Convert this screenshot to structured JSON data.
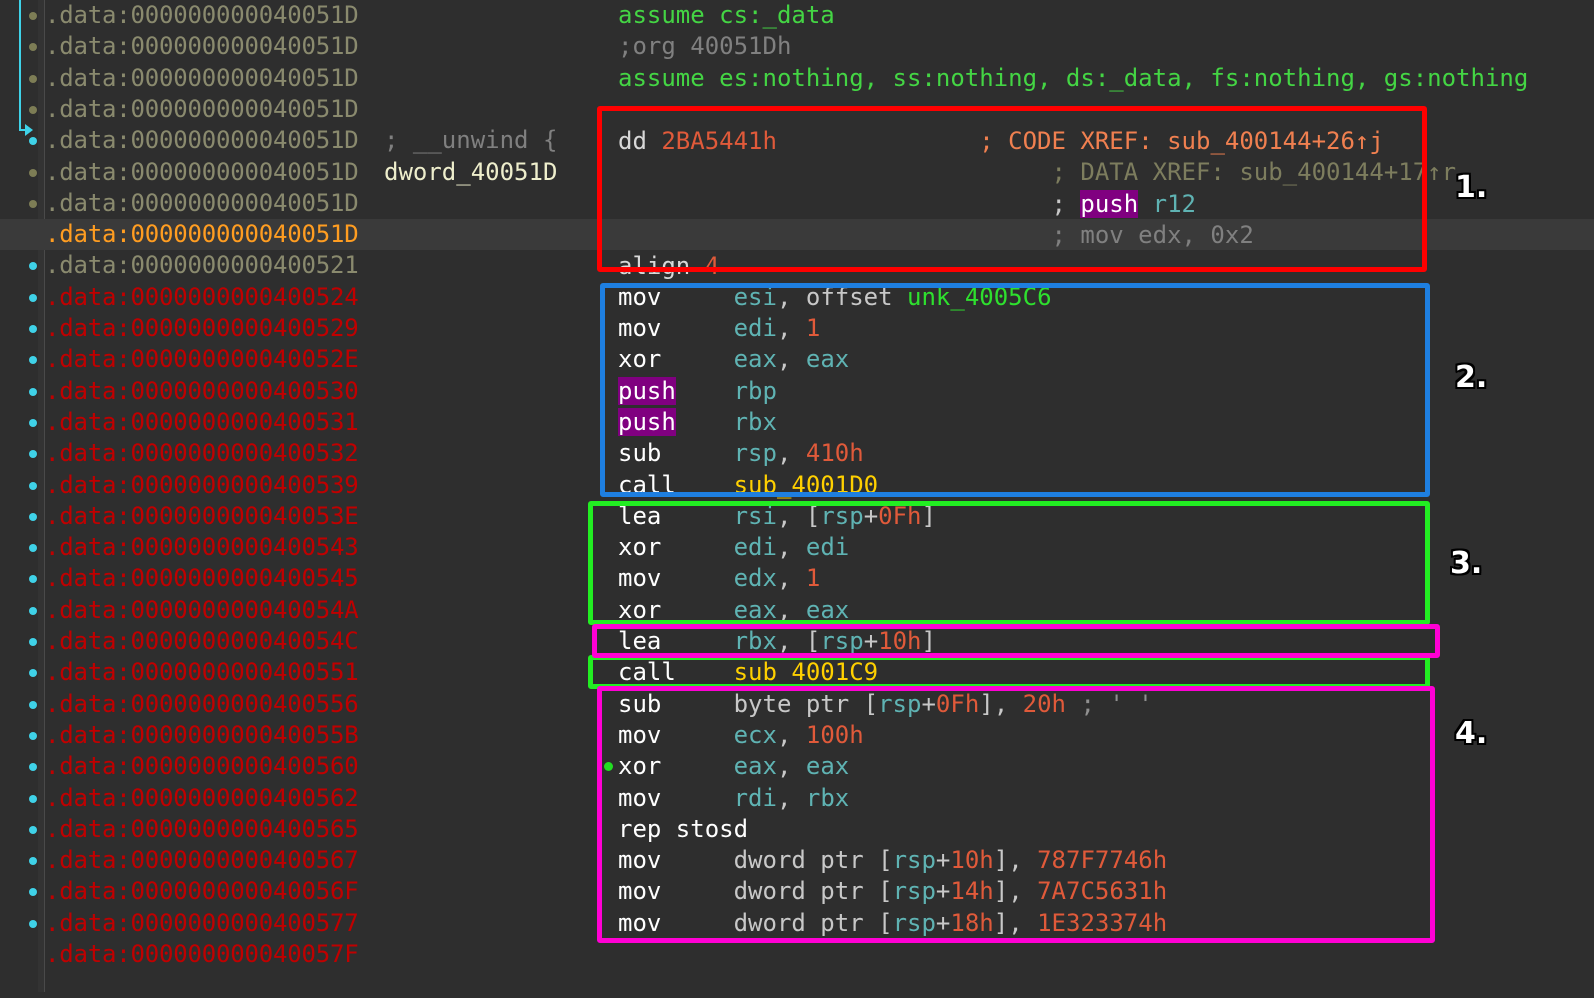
{
  "view": {
    "name": "IDA Pro disassembly listing",
    "segment": ".data",
    "background": "#2e2e2e",
    "current_line_background": "#3a3a3a"
  },
  "colors": {
    "address_grey": "#8a8a6e",
    "address_red": "#c00000",
    "address_current": "#ff9d21",
    "directive_green": "#44d544",
    "dim_grey": "#808080",
    "name_cream": "#eeeecc",
    "immediate_orange": "#e05a3a",
    "register_teal": "#5fb3b3",
    "xref_code_orange": "#f08050",
    "xref_data_olive": "#7d7d5e",
    "call_yellow": "#ffd000",
    "unk_green": "#2ee02e",
    "highlight_purple": "#800080",
    "marker_cyan": "#3fd2e8",
    "breakpoint_olive": "#7d7d55",
    "exec_dot_green": "#22dd22",
    "box_1_red": "#ff0000",
    "box_2_blue": "#1e7fe0",
    "box_3_green": "#22ee22",
    "box_4_magenta": "#ff00d4"
  },
  "gutter": {
    "arrow_icon": "jump-arrow-icon",
    "arrow_target_dot": "cyan-dot",
    "marker_dots": "breakpoint-dot"
  },
  "address_lines": [
    {
      "text": ".data:000000000040051D",
      "color": "grey",
      "dot": "olive",
      "current": false
    },
    {
      "text": ".data:000000000040051D",
      "color": "grey",
      "dot": "olive",
      "current": false
    },
    {
      "text": ".data:000000000040051D",
      "color": "grey",
      "dot": "olive",
      "current": false
    },
    {
      "text": ".data:000000000040051D",
      "color": "grey",
      "dot": "olive",
      "current": false
    },
    {
      "text": ".data:000000000040051D",
      "color": "grey",
      "dot": "cyan",
      "current": false
    },
    {
      "text": ".data:000000000040051D",
      "color": "grey",
      "dot": "olive",
      "current": false
    },
    {
      "text": ".data:000000000040051D",
      "color": "grey",
      "dot": "olive",
      "current": false
    },
    {
      "text": ".data:000000000040051D",
      "color": "cur",
      "dot": "",
      "current": true
    },
    {
      "text": ".data:0000000000400521",
      "color": "grey",
      "dot": "cyan",
      "current": false
    },
    {
      "text": ".data:0000000000400524",
      "color": "red",
      "dot": "cyan",
      "current": false
    },
    {
      "text": ".data:0000000000400529",
      "color": "red",
      "dot": "cyan",
      "current": false
    },
    {
      "text": ".data:000000000040052E",
      "color": "red",
      "dot": "cyan",
      "current": false
    },
    {
      "text": ".data:0000000000400530",
      "color": "red",
      "dot": "cyan",
      "current": false
    },
    {
      "text": ".data:0000000000400531",
      "color": "red",
      "dot": "cyan",
      "current": false
    },
    {
      "text": ".data:0000000000400532",
      "color": "red",
      "dot": "cyan",
      "current": false
    },
    {
      "text": ".data:0000000000400539",
      "color": "red",
      "dot": "cyan",
      "current": false
    },
    {
      "text": ".data:000000000040053E",
      "color": "red",
      "dot": "cyan",
      "current": false
    },
    {
      "text": ".data:0000000000400543",
      "color": "red",
      "dot": "cyan",
      "current": false
    },
    {
      "text": ".data:0000000000400545",
      "color": "red",
      "dot": "cyan",
      "current": false
    },
    {
      "text": ".data:000000000040054A",
      "color": "red",
      "dot": "cyan",
      "current": false
    },
    {
      "text": ".data:000000000040054C",
      "color": "red",
      "dot": "cyan",
      "current": false
    },
    {
      "text": ".data:0000000000400551",
      "color": "red",
      "dot": "cyan",
      "current": false
    },
    {
      "text": ".data:0000000000400556",
      "color": "red",
      "dot": "cyan",
      "current": false
    },
    {
      "text": ".data:000000000040055B",
      "color": "red",
      "dot": "cyan",
      "current": false
    },
    {
      "text": ".data:0000000000400560",
      "color": "red",
      "dot": "cyan",
      "current": false
    },
    {
      "text": ".data:0000000000400562",
      "color": "red",
      "dot": "cyan",
      "current": false
    },
    {
      "text": ".data:0000000000400565",
      "color": "red",
      "dot": "cyan",
      "current": false
    },
    {
      "text": ".data:0000000000400567",
      "color": "red",
      "dot": "cyan",
      "current": false
    },
    {
      "text": ".data:000000000040056F",
      "color": "red",
      "dot": "cyan",
      "current": false
    },
    {
      "text": ".data:0000000000400577",
      "color": "red",
      "dot": "cyan",
      "current": false
    },
    {
      "text": ".data:000000000040057F",
      "color": "red",
      "dot": "",
      "current": false
    }
  ],
  "disassembly": [
    {
      "id": "line-assume-cs",
      "plain": "assume cs:_data"
    },
    {
      "id": "line-org",
      "plain": ";org 40051Dh"
    },
    {
      "id": "line-assume-seg",
      "plain": "assume es:nothing, ss:nothing, ds:_data, fs:nothing, gs:nothing"
    },
    {
      "id": "line-blank-1",
      "plain": ""
    },
    {
      "id": "line-unwind",
      "plain": "; __unwind {"
    },
    {
      "id": "line-dword-label",
      "plain": "dword_40051D"
    },
    {
      "id": "line-dd",
      "plain": "dd 2BA5441h"
    },
    {
      "id": "line-xref-code",
      "plain": "; CODE XREF: sub_400144+26↑j"
    },
    {
      "id": "line-xref-data",
      "plain": "; DATA XREF: sub_400144+17↑r"
    },
    {
      "id": "line-cmt-push-r12",
      "plain": "; push r12"
    },
    {
      "id": "line-cmt-mov-edx",
      "plain": "; mov edx, 0x2"
    },
    {
      "id": "line-align",
      "plain": "align 4"
    },
    {
      "id": "line-mov-esi",
      "plain": "mov     esi, offset unk_4005C6"
    },
    {
      "id": "line-mov-edi",
      "plain": "mov     edi, 1"
    },
    {
      "id": "line-xor-eax-1",
      "plain": "xor     eax, eax"
    },
    {
      "id": "line-push-rbp",
      "plain": "push    rbp"
    },
    {
      "id": "line-push-rbx",
      "plain": "push    rbx"
    },
    {
      "id": "line-sub-rsp",
      "plain": "sub     rsp, 410h"
    },
    {
      "id": "line-call-4001d0",
      "plain": "call    sub_4001D0"
    },
    {
      "id": "line-lea-rsi",
      "plain": "lea     rsi, [rsp+0Fh]"
    },
    {
      "id": "line-xor-edi",
      "plain": "xor     edi, edi"
    },
    {
      "id": "line-mov-edx-1",
      "plain": "mov     edx, 1"
    },
    {
      "id": "line-xor-eax-2",
      "plain": "xor     eax, eax"
    },
    {
      "id": "line-lea-rbx",
      "plain": "lea     rbx, [rsp+10h]"
    },
    {
      "id": "line-call-4001c9",
      "plain": "call    sub_4001C9"
    },
    {
      "id": "line-sub-byte",
      "plain": "sub     byte ptr [rsp+0Fh], 20h ; ' '"
    },
    {
      "id": "line-mov-ecx",
      "plain": "mov     ecx, 100h"
    },
    {
      "id": "line-xor-eax-3",
      "plain": "xor     eax, eax"
    },
    {
      "id": "line-mov-rdi",
      "plain": "mov     rdi, rbx"
    },
    {
      "id": "line-rep-stosd",
      "plain": "rep stosd"
    },
    {
      "id": "line-mov-d10",
      "plain": "mov     dword ptr [rsp+10h], 787F7746h"
    },
    {
      "id": "line-mov-d14",
      "plain": "mov     dword ptr [rsp+14h], 7A7C5631h"
    },
    {
      "id": "line-mov-d18",
      "plain": "mov     dword ptr [rsp+18h], 1E323374h"
    }
  ],
  "tokens": {
    "assume_cs": "assume cs:_data",
    "org_comment": ";org 40051Dh",
    "assume_segments": "assume es:nothing, ss:nothing, ds:_data, fs:nothing, gs:nothing",
    "unwind_comment": "; __unwind {",
    "dword_label": "dword_40051D",
    "dd_keyword": "dd",
    "dd_value": "2BA5441h",
    "xref_code": "; CODE XREF: sub_400144+26↑j",
    "xref_data": "; DATA XREF: sub_400144+17↑r",
    "semicolon": ";",
    "push_hl": "push",
    "r12": "r12",
    "cmt_mov_edx": "; mov edx, 0x2",
    "align_keyword": "align",
    "align_value": "4",
    "mnem_mov": "mov",
    "mnem_xor": "xor",
    "mnem_push": "push",
    "mnem_sub": "sub",
    "mnem_call": "call",
    "mnem_lea": "lea",
    "mnem_rep_stosd": "rep stosd",
    "esi": "esi",
    "edi": "edi",
    "eax": "eax",
    "edx": "edx",
    "ecx": "ecx",
    "rbp": "rbp",
    "rbx": "rbx",
    "rsp": "rsp",
    "rsi": "rsi",
    "rdi": "rdi",
    "offset_kw": "offset",
    "unk_4005C6": "unk_4005C6",
    "one": "1",
    "val_410h": "410h",
    "val_100h": "100h",
    "val_20h": "20h",
    "val_0Fh": "0Fh",
    "val_10h": "10h",
    "val_14h": "14h",
    "val_18h": "18h",
    "sub_4001D0": "sub_4001D0",
    "sub_4001C9": "sub_4001C9",
    "byte_ptr": "byte ptr",
    "dword_ptr": "dword ptr",
    "space_char_comment": "; ' '",
    "hex_787F7746": "787F7746h",
    "hex_7A7C5631": "7A7C5631h",
    "hex_1E323374": "1E323374h",
    "comma": ",",
    "bracket_open": "[",
    "bracket_close": "]",
    "plus": "+"
  },
  "annotations": [
    {
      "label": "1.",
      "color": "#ff0000",
      "name": "annotation-box-1"
    },
    {
      "label": "2.",
      "color": "#1e7fe0",
      "name": "annotation-box-2"
    },
    {
      "label": "3.",
      "color": "#22ee22",
      "name": "annotation-box-3"
    },
    {
      "label": "4.",
      "color": "#ff00d4",
      "name": "annotation-box-4"
    }
  ]
}
